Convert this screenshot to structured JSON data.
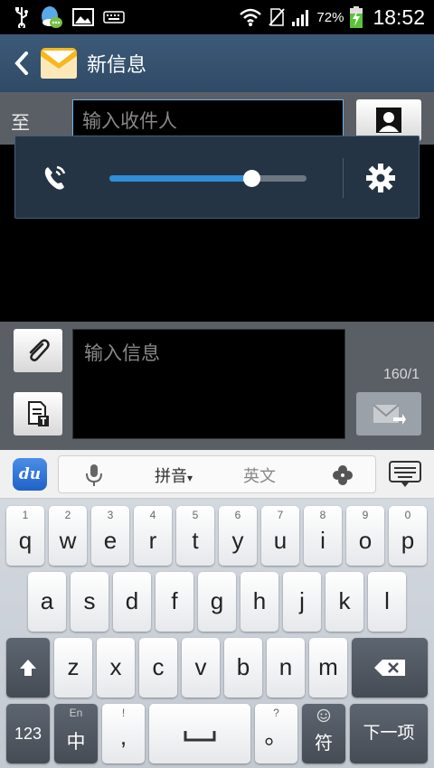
{
  "status_bar": {
    "battery_percent": "72%",
    "time": "18:52",
    "icons": [
      "usb-icon",
      "qq-icon",
      "image-icon",
      "keyboard-icon",
      "wifi-icon",
      "no-sim-icon",
      "signal-icon",
      "battery-charging-icon"
    ]
  },
  "action_bar": {
    "title": "新信息",
    "back_icon": "chevron-left-icon",
    "app_icon": "envelope-icon"
  },
  "recipient": {
    "to_label": "至",
    "placeholder": "输入收件人",
    "contact_icon": "contact-icon"
  },
  "volume_panel": {
    "icon": "phone-volume-icon",
    "level": 0.72,
    "settings_icon": "gear-icon"
  },
  "compose": {
    "placeholder": "输入信息",
    "char_count": "160/1",
    "attach_icon": "paperclip-icon",
    "template_icon": "template-icon",
    "send_icon": "send-icon"
  },
  "ime_toolbar": {
    "logo_text": "du",
    "pinyin_label": "拼音",
    "pinyin_caret": "▾",
    "english_label": "英文",
    "mic_icon": "mic-icon",
    "clover_icon": "clover-icon",
    "hide_icon": "keyboard-hide-icon"
  },
  "keyboard": {
    "row1": [
      {
        "key": "q",
        "num": "1"
      },
      {
        "key": "w",
        "num": "2"
      },
      {
        "key": "e",
        "num": "3"
      },
      {
        "key": "r",
        "num": "4"
      },
      {
        "key": "t",
        "num": "5"
      },
      {
        "key": "y",
        "num": "6"
      },
      {
        "key": "u",
        "num": "7"
      },
      {
        "key": "i",
        "num": "8"
      },
      {
        "key": "o",
        "num": "9"
      },
      {
        "key": "p",
        "num": "0"
      }
    ],
    "row2": [
      "a",
      "s",
      "d",
      "f",
      "g",
      "h",
      "j",
      "k",
      "l"
    ],
    "row3": [
      "z",
      "x",
      "c",
      "v",
      "b",
      "n",
      "m"
    ],
    "num_key": "123",
    "lang_key_top": "En",
    "lang_key_main": "中",
    "punct_key_top": "!",
    "punct_key_main": ",",
    "period_key_top": "?",
    "period_key_main": "。",
    "symbol_key_main": "符",
    "enter_label": "下一项"
  }
}
